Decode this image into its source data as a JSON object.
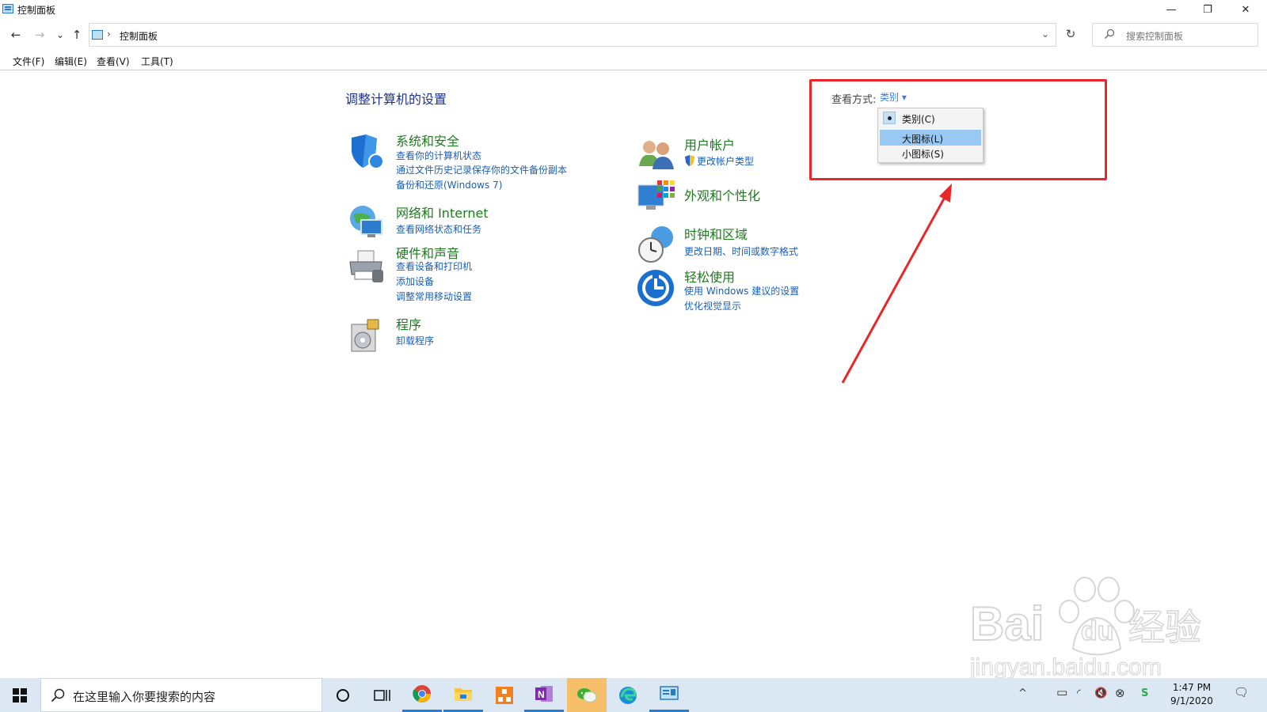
{
  "window": {
    "title": "控制面板",
    "controls": {
      "minimize": "—",
      "maximize": "❐",
      "close": "✕"
    }
  },
  "address": {
    "back": "←",
    "forward": "→",
    "recent": "⌄",
    "up": "↑",
    "separator": "›",
    "path": "控制面板",
    "dropdown": "⌄",
    "refresh": "↻",
    "search_placeholder": "搜索控制面板"
  },
  "menu": [
    "文件(F)",
    "编辑(E)",
    "查看(V)",
    "工具(T)"
  ],
  "main": {
    "heading": "调整计算机的设置",
    "categories_left": [
      {
        "icon": "shield-icon",
        "title": "系统和安全",
        "links": [
          "查看你的计算机状态",
          "通过文件历史记录保存你的文件备份副本",
          "备份和还原(Windows 7)"
        ]
      },
      {
        "icon": "network-globe-icon",
        "title": "网络和 Internet",
        "links": [
          "查看网络状态和任务"
        ]
      },
      {
        "icon": "printer-icon",
        "title": "硬件和声音",
        "links": [
          "查看设备和打印机",
          "添加设备",
          "调整常用移动设置"
        ]
      },
      {
        "icon": "programs-disc-icon",
        "title": "程序",
        "links": [
          "卸载程序"
        ]
      }
    ],
    "categories_right": [
      {
        "icon": "users-icon",
        "title": "用户帐户",
        "links": [
          "更改帐户类型"
        ]
      },
      {
        "icon": "appearance-icon",
        "title": "外观和个性化",
        "links": []
      },
      {
        "icon": "clock-globe-icon",
        "title": "时钟和区域",
        "links": [
          "更改日期、时间或数字格式"
        ]
      },
      {
        "icon": "ease-of-access-icon",
        "title": "轻松使用",
        "links": [
          "使用 Windows 建议的设置",
          "优化视觉显示"
        ]
      }
    ]
  },
  "view_by": {
    "label": "查看方式:",
    "current": "类别 ▾",
    "options": [
      {
        "label": "类别(C)",
        "checked": true,
        "highlighted": false
      },
      {
        "label": "大图标(L)",
        "checked": false,
        "highlighted": true
      },
      {
        "label": "小图标(S)",
        "checked": false,
        "highlighted": false
      }
    ]
  },
  "annotation": {
    "color": "#e8272b"
  },
  "watermark": {
    "brand": "Bai du 经验",
    "url": "jingyan.baidu.com"
  },
  "taskbar": {
    "search_placeholder": "在这里输入你要搜索的内容",
    "apps": [
      "cortana-circle-icon",
      "task-view-icon",
      "chrome-icon",
      "file-explorer-icon",
      "office-icon",
      "onenote-icon",
      "wechat-icon",
      "edge-icon",
      "control-panel-icon"
    ],
    "tray": {
      "chevron": "^",
      "battery": "▭",
      "network": "◜",
      "volume": "🔇",
      "circle_x": "⊗",
      "ime": "S"
    },
    "time": "1:47 PM",
    "date": "9/1/2020",
    "notification": "🗨"
  }
}
